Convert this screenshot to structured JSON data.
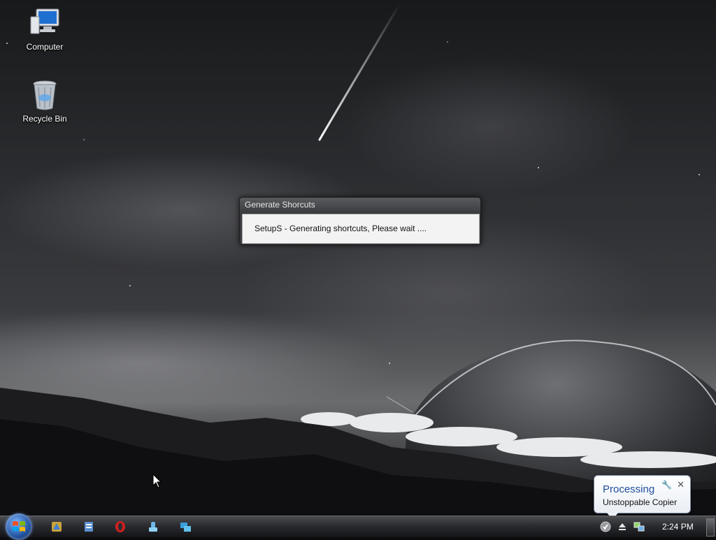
{
  "desktop": {
    "icons": [
      {
        "label": "Computer",
        "icon": "computer-icon"
      },
      {
        "label": "Recycle Bin",
        "icon": "recycle-bin-icon"
      }
    ]
  },
  "dialog": {
    "title": "Generate Shorcuts",
    "message": "SetupS - Generating shortcuts, Please wait ...."
  },
  "balloon": {
    "title": "Processing",
    "text": "Unstoppable Copier",
    "close_glyph": "✕",
    "options_glyph": "🔧"
  },
  "taskbar": {
    "start_icon": "windows-start-orb",
    "quick_launch": [
      "app-icon",
      "app-icon",
      "opera-icon",
      "app-icon",
      "app-icon"
    ],
    "tray_icons": [
      "unstoppable-copier-icon",
      "safely-remove-icon",
      "network-icon"
    ],
    "clock": "2:24 PM"
  },
  "colors": {
    "taskbar_top": "#4b4d51",
    "balloon_title": "#1f4e9c",
    "dialog_title_bg": "#4a4b4e"
  }
}
